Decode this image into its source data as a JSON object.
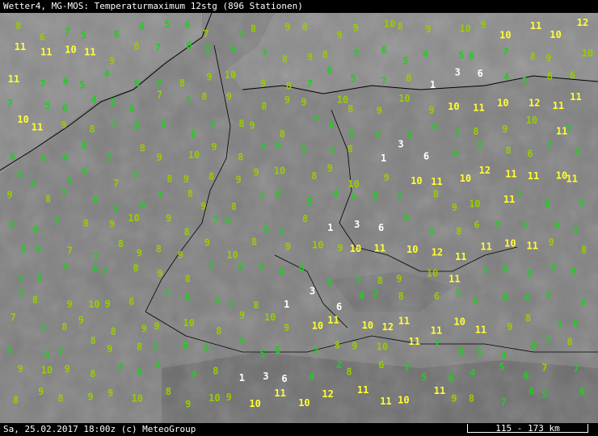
{
  "header": {
    "title": "Wetter4, MG-MOS: Temperaturmaximum 12stg (896 Stationen)"
  },
  "footer": {
    "timestamp": "Sa, 25.02.2017 18:00z (c) MeteoGroup",
    "scale": "115 - 173 km"
  },
  "colors": {
    "background": "#000000",
    "map": "#7f7f7f",
    "cold": "#22cc22",
    "mild": "#99cc00",
    "warm": "#ffff33",
    "text": "#ffffff"
  },
  "station_values": [
    {
      "v": "8",
      "c": "mild"
    },
    {
      "v": "6",
      "c": "mild"
    },
    {
      "v": "7",
      "c": "cold"
    },
    {
      "v": "5",
      "c": "cold"
    },
    {
      "v": "6",
      "c": "cold"
    },
    {
      "v": "4",
      "c": "cold"
    },
    {
      "v": "5",
      "c": "cold"
    },
    {
      "v": "6",
      "c": "cold"
    },
    {
      "v": "7",
      "c": "mild"
    },
    {
      "v": "7",
      "c": "cold"
    },
    {
      "v": "8",
      "c": "mild"
    },
    {
      "v": "9",
      "c": "mild"
    },
    {
      "v": "8",
      "c": "mild"
    },
    {
      "v": "9",
      "c": "mild"
    },
    {
      "v": "9",
      "c": "mild"
    },
    {
      "v": "10",
      "c": "mild"
    },
    {
      "v": "8",
      "c": "mild"
    },
    {
      "v": "9",
      "c": "mild"
    },
    {
      "v": "10",
      "c": "mild"
    },
    {
      "v": "9",
      "c": "mild"
    },
    {
      "v": "10",
      "c": "warm"
    },
    {
      "v": "11",
      "c": "warm"
    },
    {
      "v": "10",
      "c": "warm"
    },
    {
      "v": "12",
      "c": "warm"
    },
    {
      "v": "11",
      "c": "warm"
    },
    {
      "v": "11",
      "c": "warm"
    },
    {
      "v": "10",
      "c": "warm"
    },
    {
      "v": "11",
      "c": "warm"
    },
    {
      "v": "9",
      "c": "mild"
    },
    {
      "v": "8",
      "c": "mild"
    },
    {
      "v": "7",
      "c": "cold"
    },
    {
      "v": "6",
      "c": "cold"
    },
    {
      "v": "5",
      "c": "cold"
    },
    {
      "v": "6",
      "c": "cold"
    },
    {
      "v": "7",
      "c": "cold"
    },
    {
      "v": "8",
      "c": "mild"
    },
    {
      "v": "9",
      "c": "mild"
    },
    {
      "v": "8",
      "c": "mild"
    },
    {
      "v": "7",
      "c": "cold"
    },
    {
      "v": "6",
      "c": "cold"
    },
    {
      "v": "5",
      "c": "cold"
    },
    {
      "v": "4",
      "c": "cold"
    },
    {
      "v": "5",
      "c": "cold"
    },
    {
      "v": "6",
      "c": "cold"
    },
    {
      "v": "7",
      "c": "cold"
    },
    {
      "v": "8",
      "c": "mild"
    },
    {
      "v": "9",
      "c": "mild"
    },
    {
      "v": "10",
      "c": "mild"
    },
    {
      "v": "11",
      "c": "warm"
    },
    {
      "v": "7",
      "c": "cold"
    },
    {
      "v": "6",
      "c": "cold"
    },
    {
      "v": "5",
      "c": "cold"
    },
    {
      "v": "4",
      "c": "cold"
    },
    {
      "v": "6",
      "c": "cold"
    },
    {
      "v": "7",
      "c": "cold"
    },
    {
      "v": "8",
      "c": "mild"
    },
    {
      "v": "9",
      "c": "mild"
    },
    {
      "v": "10",
      "c": "mild"
    },
    {
      "v": "9",
      "c": "mild"
    },
    {
      "v": "8",
      "c": "mild"
    },
    {
      "v": "7",
      "c": "cold"
    },
    {
      "v": "6",
      "c": "cold"
    },
    {
      "v": "5",
      "c": "cold"
    },
    {
      "v": "7",
      "c": "cold"
    },
    {
      "v": "8",
      "c": "mild"
    },
    {
      "v": "1",
      "c": "text"
    },
    {
      "v": "3",
      "c": "text"
    },
    {
      "v": "6",
      "c": "text"
    },
    {
      "v": "4",
      "c": "cold"
    },
    {
      "v": "2",
      "c": "cold"
    }
  ]
}
